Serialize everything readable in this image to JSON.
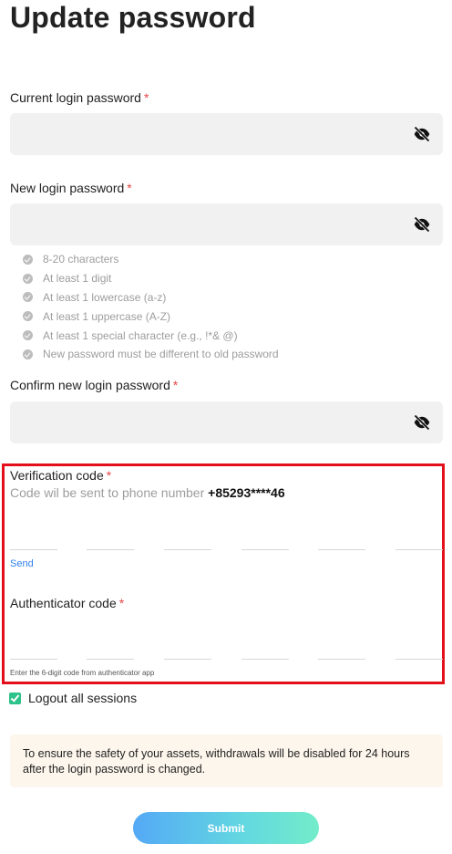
{
  "page_title": "Update password",
  "required_mark": "*",
  "current_password": {
    "label": "Current login password"
  },
  "new_password": {
    "label": "New login password",
    "rules": [
      "8-20 characters",
      "At least 1 digit",
      "At least 1 lowercase (a-z)",
      "At least 1 uppercase (A-Z)",
      "At least 1 special character (e.g., !*& @)",
      "New password must be different to old password"
    ]
  },
  "confirm_password": {
    "label": "Confirm new login password"
  },
  "verification": {
    "label": "Verification code",
    "hint_prefix": "Code wil be sent to phone number ",
    "phone": "+85293****46",
    "send_label": "Send"
  },
  "authenticator": {
    "label": "Authenticator code",
    "hint": "Enter the 6-digit code from authenticator app"
  },
  "logout": {
    "label": "Logout all sessions",
    "checked": true
  },
  "notice": "To ensure the safety of your assets, withdrawals will be disabled for 24 hours after the login password is changed.",
  "submit_label": "Submit",
  "colors": {
    "accent_gradient_start": "#54a9f6",
    "accent_gradient_end": "#72ecc9",
    "required": "#e64545",
    "highlight_border": "#e3101b",
    "link": "#2f80ed",
    "checkbox": "#2cc28a"
  }
}
